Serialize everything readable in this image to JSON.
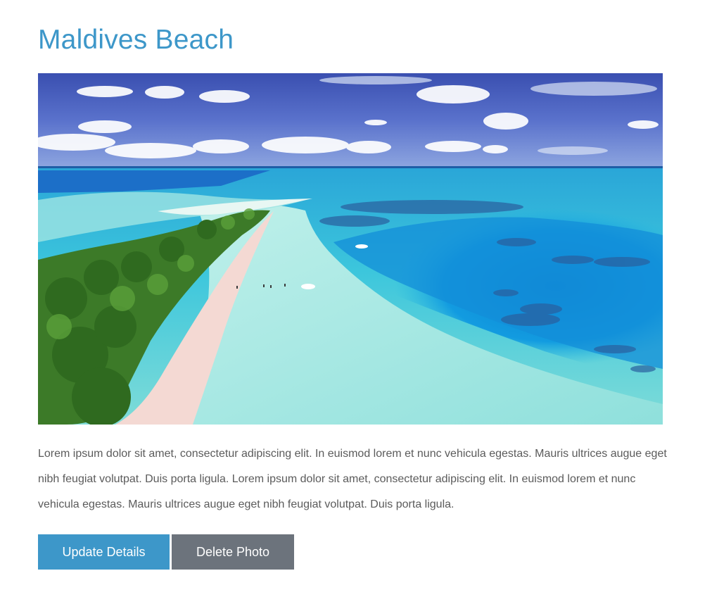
{
  "post": {
    "title": "Maldives Beach",
    "image_alt": "Aerial view of a Maldives island beach with turquoise water",
    "description": "Lorem ipsum dolor sit amet, consectetur adipiscing elit. In euismod lorem et nunc vehicula egestas. Mauris ultrices augue eget nibh feugiat volutpat. Duis porta ligula. Lorem ipsum dolor sit amet, consectetur adipiscing elit. In euismod lorem et nunc vehicula egestas. Mauris ultrices augue eget nibh feugiat volutpat. Duis porta ligula."
  },
  "actions": {
    "update_label": "Update Details",
    "delete_label": "Delete Photo"
  },
  "colors": {
    "accent": "#3d97c9",
    "secondary": "#6c737c"
  }
}
